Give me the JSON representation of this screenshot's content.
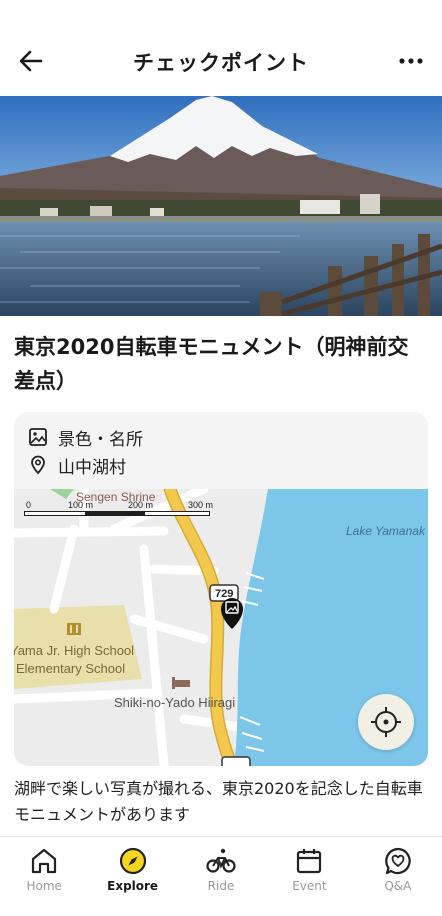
{
  "header": {
    "title": "チェックポイント",
    "back_icon": "arrow-left-icon",
    "more_icon": "more-horizontal-icon"
  },
  "spot": {
    "title": "東京2020自転車モニュメント（明神前交差点）",
    "category": "景色・名所",
    "location": "山中湖村",
    "description": "湖畔で楽しい写真が撮れる、東京2020を記念した自転車モニュメントがあります"
  },
  "map": {
    "labels": {
      "sengen": "Sengen Shrine",
      "lake": "Lake Yamanak",
      "school1": "Yama Jr. High School",
      "school2": "Elementary School",
      "inn": "Shiki-no-Yado Hiiragi",
      "route": "729"
    },
    "scale": {
      "s0": "0",
      "s100": "100 m",
      "s200": "200 m",
      "s300": "300 m"
    }
  },
  "nav": {
    "items": [
      {
        "label": "Home",
        "icon": "home-icon",
        "active": false
      },
      {
        "label": "Explore",
        "icon": "compass-icon",
        "active": true
      },
      {
        "label": "Ride",
        "icon": "bicycle-icon",
        "active": false
      },
      {
        "label": "Event",
        "icon": "calendar-icon",
        "active": false
      },
      {
        "label": "Q&A",
        "icon": "chat-heart-icon",
        "active": false
      }
    ]
  },
  "colors": {
    "accent": "#f7d51c",
    "road_main": "#f2c94c",
    "water": "#7cc6ea",
    "school_area": "#e8dfaa"
  }
}
